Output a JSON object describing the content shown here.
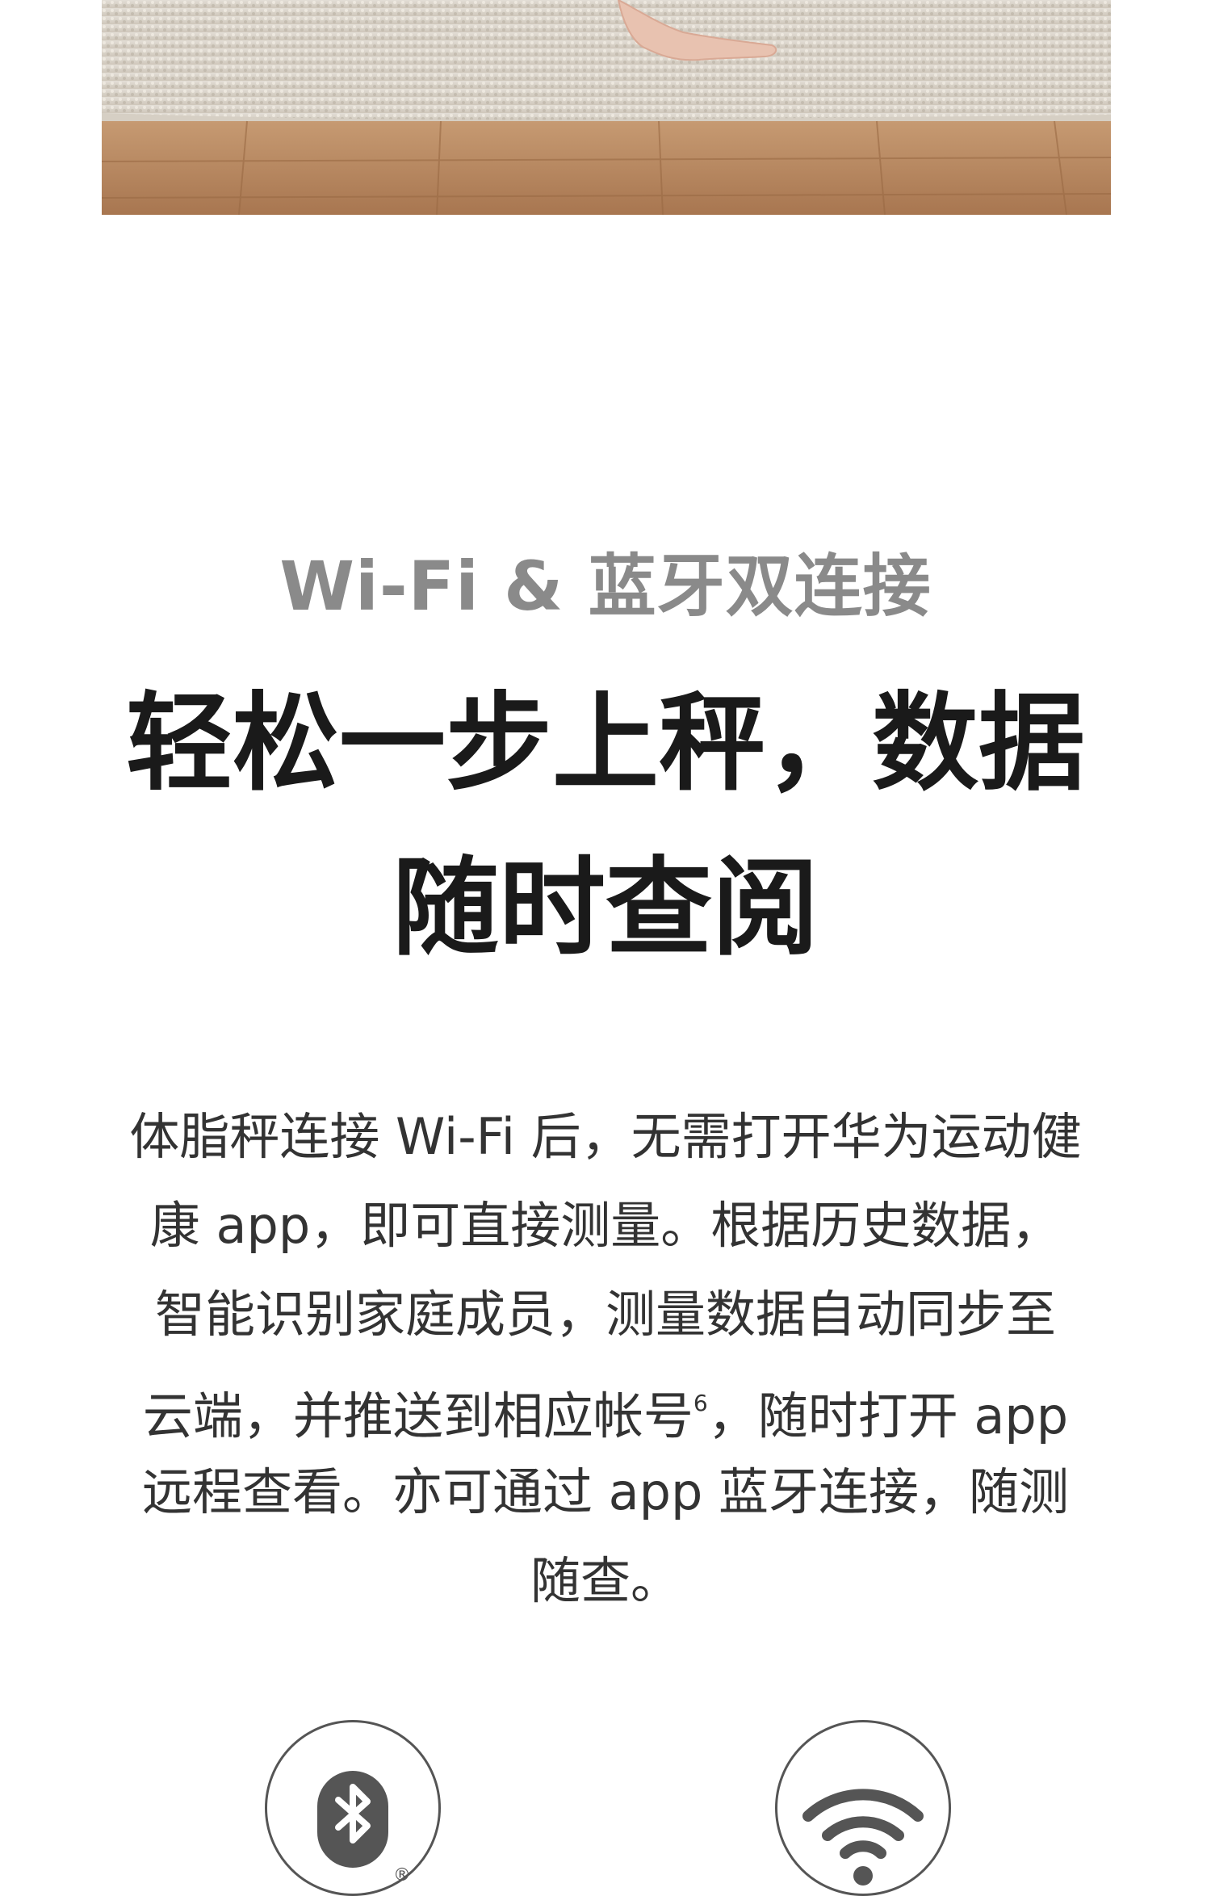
{
  "section": {
    "subtitle": "Wi-Fi & 蓝牙双连接",
    "headline_lines": [
      "轻松一步上秤，数据",
      "随时查阅"
    ],
    "body_lines": [
      "体脂秤连接 Wi-Fi 后，无需打开华为运动健",
      "康 app，即可直接测量。根据历史数据，",
      "智能识别家庭成员，测量数据自动同步至",
      "云端，并推送到相应帐号",
      "，随时打开 app",
      "远程查看。亦可通过 app 蓝牙连接，随测",
      "随查。"
    ],
    "footnote_mark": "6"
  },
  "icons": {
    "bluetooth": {
      "name": "bluetooth-icon",
      "registered_mark": "®"
    },
    "wifi": {
      "name": "wifi-icon"
    }
  },
  "colors": {
    "subtitle": "#8a8a8a",
    "headline": "#1a1a1a",
    "body": "#333333",
    "icon": "#555555"
  }
}
